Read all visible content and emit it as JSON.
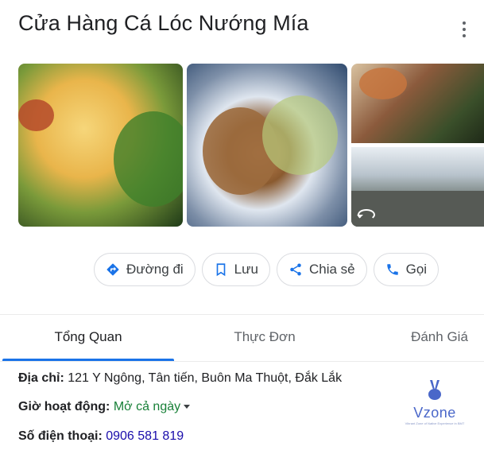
{
  "header": {
    "title": "Cửa Hàng Cá Lóc Nướng Mía"
  },
  "actions": [
    {
      "label": "Đường đi",
      "icon": "directions-icon"
    },
    {
      "label": "Lưu",
      "icon": "bookmark-icon"
    },
    {
      "label": "Chia sẻ",
      "icon": "share-icon"
    },
    {
      "label": "Gọi",
      "icon": "phone-icon"
    }
  ],
  "tabs": [
    {
      "label": "Tổng Quan",
      "active": true
    },
    {
      "label": "Thực Đơn",
      "active": false
    },
    {
      "label": "Đánh Giá",
      "active": false
    }
  ],
  "info": {
    "address_label": "Địa chỉ:",
    "address_value": "121 Y Ngông, Tân tiến, Buôn Ma Thuột, Đắk Lắk",
    "hours_label": "Giờ hoạt động:",
    "hours_value": "Mở cả ngày",
    "phone_label": "Số điện thoại:",
    "phone_value": "0906 581 819"
  },
  "logo": {
    "name": "Vzone",
    "tagline": "Vibrant Zone of Native Experience in BMT"
  },
  "colors": {
    "accent": "#1a73e8",
    "open_status": "#188038",
    "link": "#1a0dab"
  }
}
